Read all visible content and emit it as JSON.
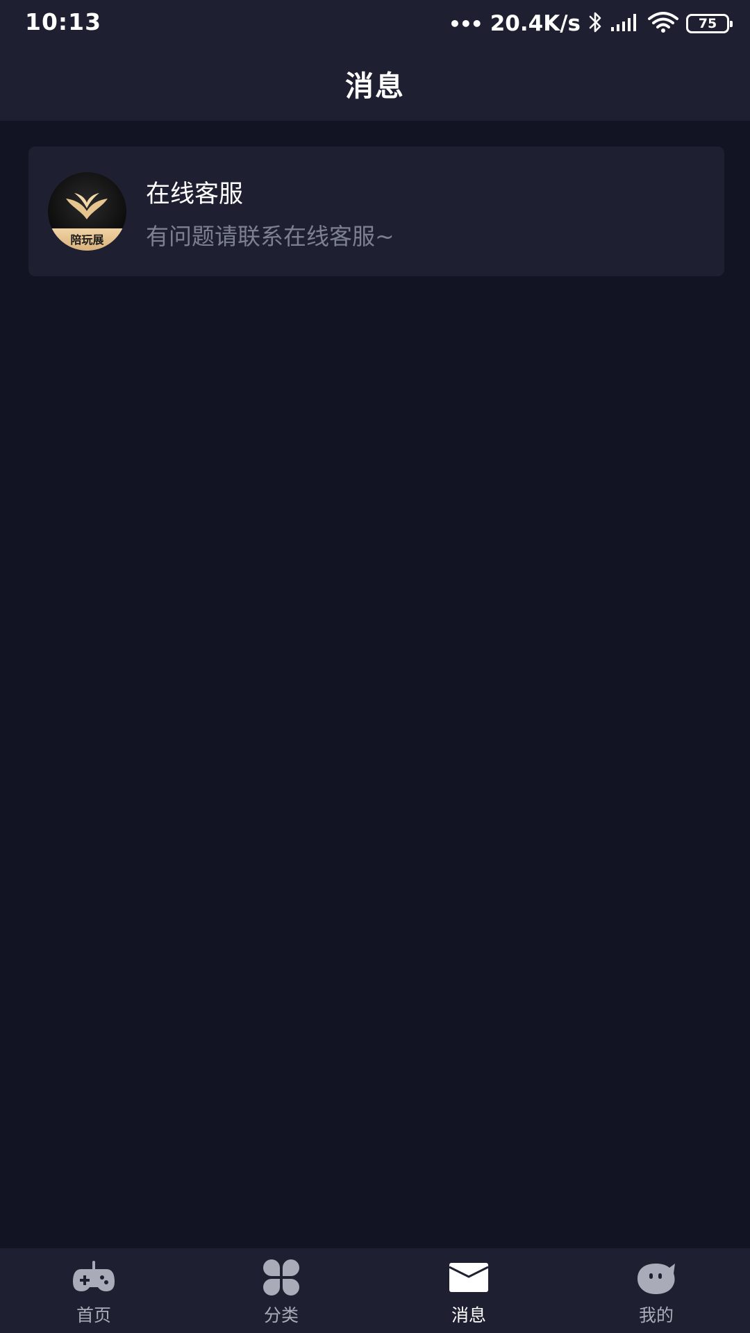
{
  "status_bar": {
    "time": "10:13",
    "dots": "•••",
    "net_speed": "20.4K/s",
    "battery": "75",
    "icons": [
      "bluetooth-icon",
      "signal-icon",
      "wifi-icon",
      "battery-icon"
    ]
  },
  "header": {
    "title": "消息"
  },
  "messages": [
    {
      "name": "在线客服",
      "preview": "有问题请联系在线客服~",
      "avatar_text": "陪玩展",
      "avatar_icon": "brand-logo-icon"
    }
  ],
  "bottom_nav": {
    "items": [
      {
        "label": "首页",
        "icon": "gamepad-icon",
        "active": false
      },
      {
        "label": "分类",
        "icon": "grid-icon",
        "active": false
      },
      {
        "label": "消息",
        "icon": "envelope-icon",
        "active": true
      },
      {
        "label": "我的",
        "icon": "face-icon",
        "active": false
      }
    ]
  },
  "colors": {
    "background": "#121424",
    "surface": "#1e2032",
    "text_primary": "#ffffff",
    "text_secondary": "#7c8090",
    "nav_inactive": "#a9acb8",
    "accent_gold": "#e7c58e"
  }
}
